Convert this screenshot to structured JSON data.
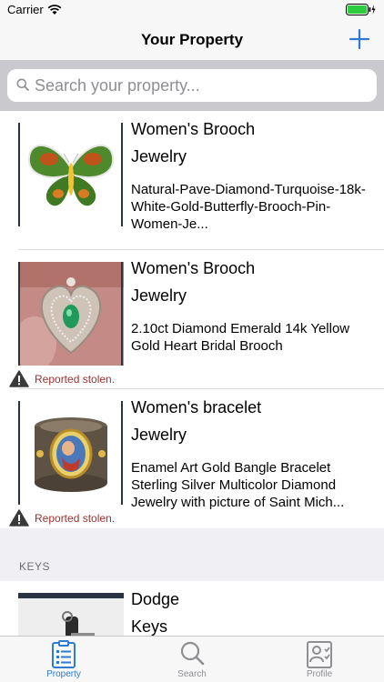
{
  "status_bar": {
    "carrier": "Carrier",
    "time": ""
  },
  "nav": {
    "title": "Your Property"
  },
  "search": {
    "placeholder": "Search your property..."
  },
  "items": [
    {
      "title": "Women's Brooch",
      "category": "Jewelry",
      "description": "Natural-Pave-Diamond-Turquoise-18k-White-Gold-Butterfly-Brooch-Pin-Women-Je...",
      "stolen": false
    },
    {
      "title": "Women's Brooch",
      "category": "Jewelry",
      "description": "2.10ct Diamond Emerald 14k Yellow Gold Heart Bridal Brooch",
      "stolen": true,
      "stolen_label": "Reported stolen."
    },
    {
      "title": "Women's bracelet",
      "category": "Jewelry",
      "description": "Enamel Art Gold Bangle Bracelet Sterling Silver Multicolor Diamond Jewelry with picture of Saint Mich...",
      "stolen": true,
      "stolen_label": "Reported stolen."
    }
  ],
  "section_keys": {
    "header": "KEYS",
    "items": [
      {
        "title": "Dodge",
        "category": "Keys"
      }
    ]
  },
  "tabs": [
    {
      "label": "Property",
      "icon": "property-icon",
      "active": true
    },
    {
      "label": "Search",
      "icon": "search-icon",
      "active": false
    },
    {
      "label": "Profile",
      "icon": "profile-icon",
      "active": false
    }
  ],
  "colors": {
    "accent": "#2e7bcf",
    "stolen_text": "#9b2f2f",
    "section_bg": "#efeff4",
    "search_bar_bg": "#c9c9ce"
  }
}
